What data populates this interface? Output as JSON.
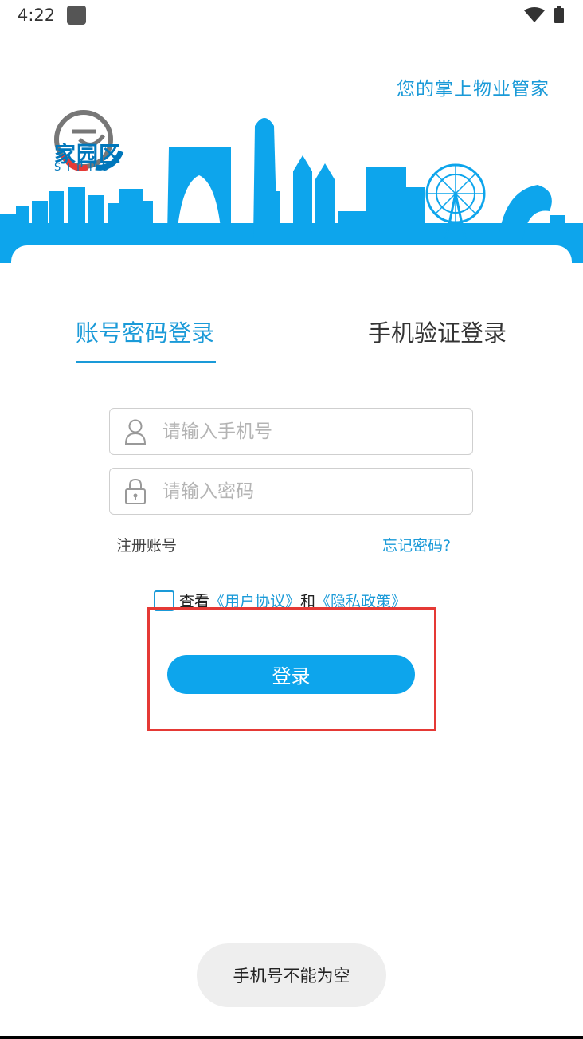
{
  "status_bar": {
    "time": "4:22"
  },
  "header": {
    "logo_title": "家园区",
    "logo_sub": "SIPPS",
    "slogan": "您的掌上物业管家"
  },
  "tabs": [
    {
      "label": "账号密码登录",
      "selected": true
    },
    {
      "label": "手机验证登录",
      "selected": false
    }
  ],
  "form": {
    "phone_placeholder": "请输入手机号",
    "phone_value": "",
    "password_placeholder": "请输入密码",
    "password_value": "",
    "register_label": "注册账号",
    "forgot_label": "忘记密码?",
    "agreement": {
      "checked": false,
      "prefix": "查看",
      "user_agreement": "《用户协议》",
      "and": "和",
      "privacy_policy": "《隐私政策》"
    },
    "login_label": "登录"
  },
  "toast": "手机号不能为空",
  "colors": {
    "accent": "#1a9ad8",
    "button": "#0da5ec",
    "skyline": "#0da5ec",
    "highlight": "#e53935"
  }
}
